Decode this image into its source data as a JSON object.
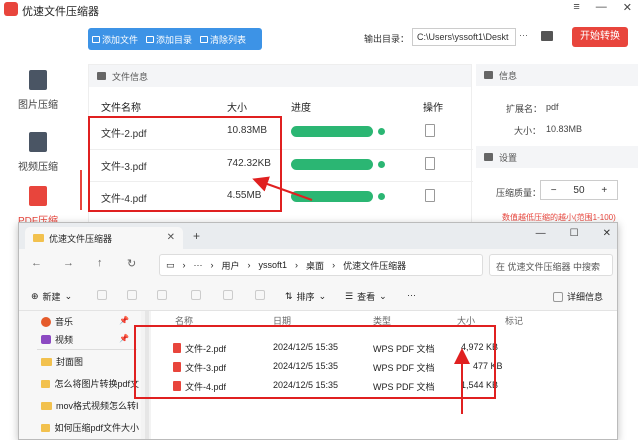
{
  "app": {
    "title": "优速文件压缩器",
    "window_buttons": [
      "≡",
      "—",
      "✕"
    ]
  },
  "sidebar": {
    "items": [
      {
        "label": "图片压缩",
        "active": false
      },
      {
        "label": "视频压缩",
        "active": false
      },
      {
        "label": "PDF压缩",
        "active": true
      }
    ]
  },
  "toolbar": {
    "add_file": "添加文件",
    "add_dir": "添加目录",
    "clear_list": "清除列表",
    "output_label": "输出目录：",
    "output_path": "C:\\Users\\yssoft1\\Deskt",
    "more": "···",
    "start": "开始转换"
  },
  "file_panel": {
    "header": "文件信息",
    "columns": [
      "文件名称",
      "大小",
      "进度",
      "操作"
    ],
    "rows": [
      {
        "name": "文件-2.pdf",
        "size": "10.83MB",
        "progress": 1.0
      },
      {
        "name": "文件-3.pdf",
        "size": "742.32KB",
        "progress": 1.0
      },
      {
        "name": "文件-4.pdf",
        "size": "4.55MB",
        "progress": 1.0
      }
    ]
  },
  "info_panel": {
    "header": "信息",
    "ext_label": "扩展名：",
    "ext_value": "pdf",
    "size_label": "大小：",
    "size_value": "10.83MB",
    "settings_header": "设置",
    "quality_label": "压缩质量：",
    "quality_minus": "−",
    "quality_value": "50",
    "quality_plus": "+",
    "hint": "数值越低压缩的越小(范围1-100)"
  },
  "explorer": {
    "tab_title": "优速文件压缩器",
    "tab_close": "✕",
    "tab_new": "+",
    "window_buttons": [
      "—",
      "☐",
      "✕"
    ],
    "nav": {
      "back": "←",
      "forward": "→",
      "up": "↑",
      "refresh": "↻"
    },
    "address": [
      "用户",
      "yssoft1",
      "桌面",
      "优速文件压缩器"
    ],
    "address_more": "···",
    "search_placeholder": "在 优速文件压缩器 中搜索",
    "commands": {
      "new": "新建",
      "sort": "排序",
      "view": "查看",
      "more": "···",
      "details": "详细信息"
    },
    "left_items": [
      {
        "label": "音乐",
        "pinned": true,
        "icon": "music-icon"
      },
      {
        "label": "视频",
        "pinned": true,
        "icon": "video-icon"
      },
      {
        "label": "封面图",
        "pinned": false,
        "icon": "folder-icon"
      },
      {
        "label": "怎么将图片转换pdf文",
        "pinned": false,
        "icon": "folder-icon"
      },
      {
        "label": "mov格式视频怎么转I",
        "pinned": false,
        "icon": "folder-icon"
      },
      {
        "label": "如何压缩pdf文件大小",
        "pinned": false,
        "icon": "folder-icon"
      }
    ],
    "columns": [
      "名称",
      "日期",
      "类型",
      "大小",
      "标记"
    ],
    "files": [
      {
        "name": "文件-2.pdf",
        "date": "2024/12/5 15:35",
        "type": "WPS PDF 文档",
        "size": "4,972 KB"
      },
      {
        "name": "文件-3.pdf",
        "date": "2024/12/5 15:35",
        "type": "WPS PDF 文档",
        "size": "477 KB"
      },
      {
        "name": "文件-4.pdf",
        "date": "2024/12/5 15:35",
        "type": "WPS PDF 文档",
        "size": "1,544 KB"
      }
    ]
  },
  "colors": {
    "accent": "#e8453c",
    "toolbar_blue": "#3d93e6",
    "progress_green": "#2bb673",
    "highlight_red": "#e02020"
  }
}
